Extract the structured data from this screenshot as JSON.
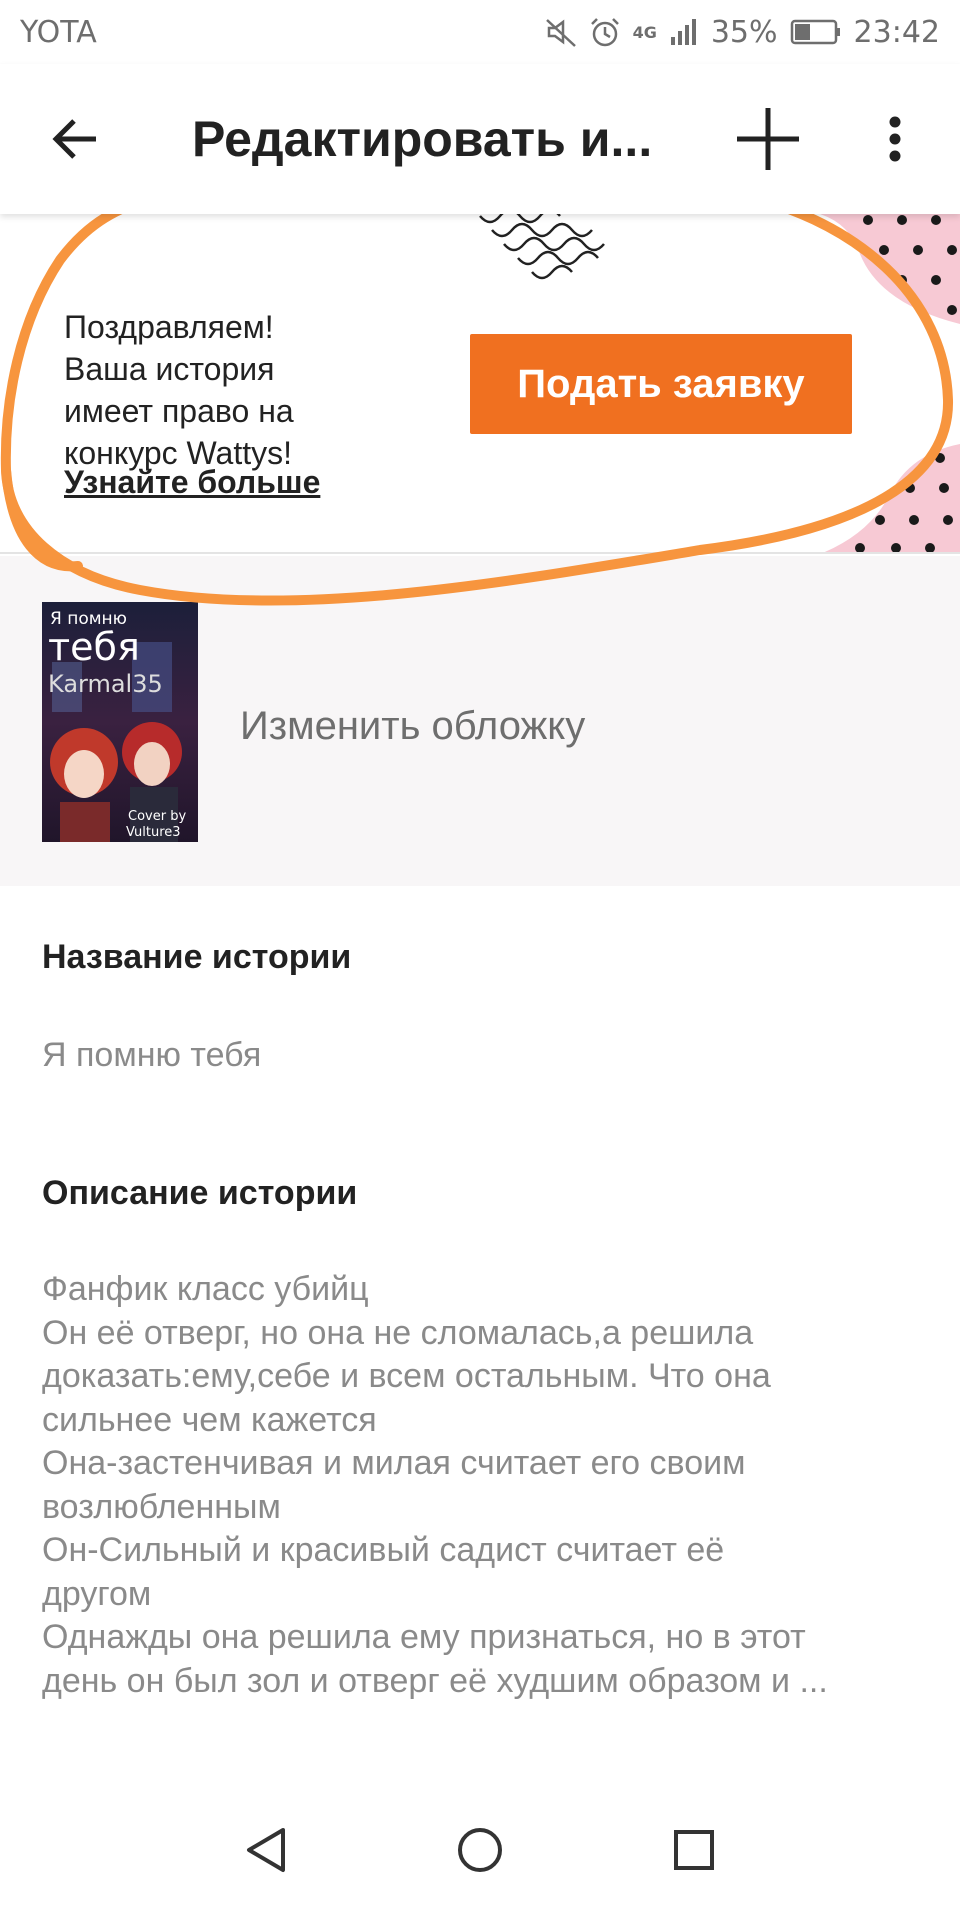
{
  "status_bar": {
    "carrier": "YOTA",
    "network": "4G",
    "battery": "35%",
    "time": "23:42",
    "icons": [
      "mute-icon",
      "alarm-icon",
      "signal-icon",
      "battery-icon"
    ]
  },
  "toolbar": {
    "title": "Редактировать и...",
    "icons": [
      "back-arrow-icon",
      "plus-icon",
      "more-vert-icon"
    ]
  },
  "banner": {
    "lines": [
      "Поздравляем!",
      "Ваша история",
      "имеет право на",
      "конкурс Wattys!"
    ],
    "learn_more": "Узнайте больше",
    "apply_button": "Подать заявку",
    "button_color": "#f07020"
  },
  "cover": {
    "image_texts": [
      "Я помню",
      "тебя",
      "Karmal35",
      "Cover by",
      "Vulture3"
    ],
    "change_label": "Изменить обложку"
  },
  "story": {
    "title_label": "Название истории",
    "title_value": "Я помню тебя",
    "desc_label": "Описание истории",
    "desc_lines": [
      "Фанфик класс убийц",
      "Он её отверг, но она не сломалась,а решила",
      "доказать:ему,себе и всем остальным. Что она",
      "сильнее чем кажется",
      "Она-застенчивая и милая считает его своим",
      "возлюбленным",
      "Он-Сильный и красивый садист считает её",
      "другом",
      "Однажды она решила ему признаться, но в этот",
      "день он был зол и отверг её худшим образом и ..."
    ]
  },
  "navbar": {
    "icons": [
      "back-triangle-icon",
      "home-circle-icon",
      "recents-square-icon"
    ]
  },
  "colors": {
    "accent": "#f07020",
    "annotation": "#f7953e",
    "dots_bg": "#f7c9d4"
  }
}
